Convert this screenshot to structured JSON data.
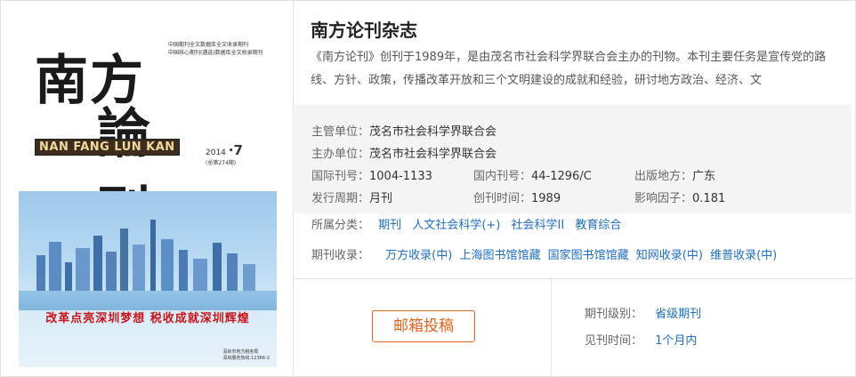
{
  "journal": {
    "title": "南方论刊杂志",
    "description": "《南方论刊》创刊于1989年，是由茂名市社会科学界联合会主办的刊物。本刊主要任务是宣传党的路线、方针、政策，传播改革开放和三个文明建设的成就和经验，研讨地方政治、经济、文"
  },
  "cover": {
    "title_line1": "南方",
    "title_line2": "論刊",
    "subtitle_line1": "中国期刊全文数据库全文收录期刊",
    "subtitle_line2": "中国核心期刊(遴选)数据库全文收录期刊",
    "band": "NAN FANG LUN KAN",
    "issue_year": "2014",
    "issue_total": "(总第274期)",
    "issue_num": "·7",
    "slogan": "改革点亮深圳梦想  税收成就深圳辉煌",
    "foot_line1": "深圳市地方税务局",
    "foot_line2": "深圳服务热线:12366-2"
  },
  "info": {
    "supervisor_label": "主管单位：",
    "supervisor": "茂名市社会科学界联合会",
    "sponsor_label": "主办单位：",
    "sponsor": "茂名市社会科学界联合会",
    "issn_label": "国际刊号：",
    "issn": "1004-1133",
    "cn_label": "国内刊号：",
    "cn": "44-1296/C",
    "place_label": "出版地方：",
    "place": "广东",
    "cycle_label": "发行周期：",
    "cycle": "月刊",
    "founded_label": "创刊时间：",
    "founded": "1989",
    "impact_label": "影响因子：",
    "impact": "0.181"
  },
  "categories": {
    "label": "所属分类：",
    "items": [
      "期刊",
      "人文社会科学(+)",
      "社会科学II",
      "教育综合"
    ]
  },
  "indexing": {
    "label": "期刊收录：",
    "items": [
      "万方收录(中)",
      "上海图书馆馆藏",
      "国家图书馆馆藏",
      "知网收录(中)",
      "维普收录(中)"
    ]
  },
  "submit": {
    "label": "邮箱投稿"
  },
  "level": {
    "label": "期刊级别：",
    "value": "省级期刊"
  },
  "publish": {
    "label": "见刊时间：",
    "value": "1个月内"
  }
}
